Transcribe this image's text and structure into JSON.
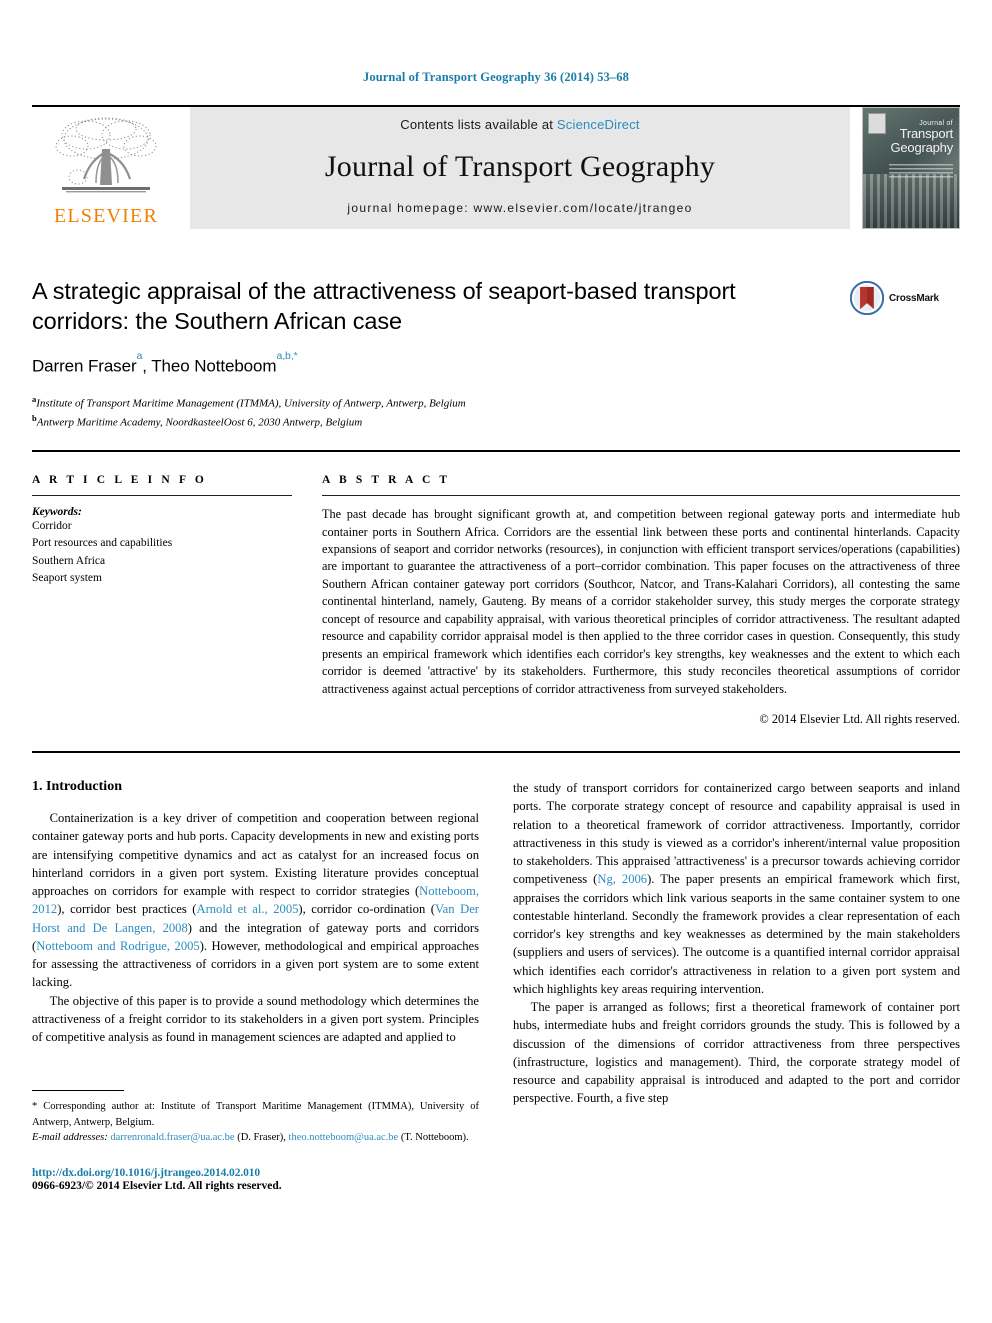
{
  "running_head": "Journal of Transport Geography 36 (2014) 53–68",
  "masthead": {
    "publisher_name": "ELSEVIER",
    "contents_prefix": "Contents lists available at",
    "sciencedirect": "ScienceDirect",
    "journal_title": "Journal of Transport Geography",
    "homepage": "journal homepage: www.elsevier.com/locate/jtrangeo",
    "cover": {
      "line1": "Journal of",
      "line2": "Transport",
      "line3": "Geography"
    }
  },
  "crossmark": {
    "label": "CrossMark"
  },
  "article": {
    "title": "A strategic appraisal of the attractiveness of seaport-based transport corridors: the Southern African case",
    "authors": [
      {
        "name": "Darren Fraser",
        "marks": "a"
      },
      {
        "name": "Theo Notteboom",
        "marks": "a,b,*"
      }
    ],
    "affiliations": [
      {
        "mark": "a",
        "text": "Institute of Transport Maritime Management (ITMMA), University of Antwerp, Antwerp, Belgium"
      },
      {
        "mark": "b",
        "text": "Antwerp Maritime Academy, NoordkasteelOost 6, 2030 Antwerp, Belgium"
      }
    ]
  },
  "article_info": {
    "heading": "A R T I C L E  I N F O",
    "keywords_label": "Keywords:",
    "keywords": [
      "Corridor",
      "Port resources and capabilities",
      "Southern Africa",
      "Seaport system"
    ]
  },
  "abstract": {
    "heading": "A B S T R A C T",
    "text": "The past decade has brought significant growth at, and competition between regional gateway ports and intermediate hub container ports in Southern Africa. Corridors are the essential link between these ports and continental hinterlands. Capacity expansions of seaport and corridor networks (resources), in conjunction with efficient transport services/operations (capabilities) are important to guarantee the attractiveness of a port–corridor combination. This paper focuses on the attractiveness of three Southern African container gateway port corridors (Southcor, Natcor, and Trans-Kalahari Corridors), all contesting the same continental hinterland, namely, Gauteng. By means of a corridor stakeholder survey, this study merges the corporate strategy concept of resource and capability appraisal, with various theoretical principles of corridor attractiveness. The resultant adapted resource and capability corridor appraisal model is then applied to the three corridor cases in question. Consequently, this study presents an empirical framework which identifies each corridor's key strengths, key weaknesses and the extent to which each corridor is deemed 'attractive' by its stakeholders. Furthermore, this study reconciles theoretical assumptions of corridor attractiveness against actual perceptions of corridor attractiveness from surveyed stakeholders.",
    "copyright": "© 2014 Elsevier Ltd. All rights reserved."
  },
  "body": {
    "section_title": "1. Introduction",
    "left_p1_a": "Containerization is a key driver of competition and cooperation between regional container gateway ports and hub ports. Capacity developments in new and existing ports are intensifying competitive dynamics and act as catalyst for an increased focus on hinterland corridors in a given port system. Existing literature provides conceptual approaches on corridors for example with respect to corridor strategies (",
    "cite1": "Notteboom, 2012",
    "left_p1_b": "), corridor best practices (",
    "cite2": "Arnold et al., 2005",
    "left_p1_c": "), corridor co-ordination (",
    "cite3": "Van Der Horst and De Langen, 2008",
    "left_p1_d": ") and the integration of gateway ports and corridors (",
    "cite4": "Notteboom and Rodrigue, 2005",
    "left_p1_e": "). However, methodological and empirical approaches for assessing the attractiveness of corridors in a given port system are to some extent lacking.",
    "left_p2": "The objective of this paper is to provide a sound methodology which determines the attractiveness of a freight corridor to its stakeholders in a given port system. Principles of competitive analysis as found in management sciences are adapted and applied to",
    "right_p1_a": "the study of transport corridors for containerized cargo between seaports and inland ports. The corporate strategy concept of resource and capability appraisal is used in relation to a theoretical framework of corridor attractiveness. Importantly, corridor attractiveness in this study is viewed as a corridor's inherent/internal value proposition to stakeholders. This appraised 'attractiveness' is a precursor towards achieving corridor competiveness (",
    "cite5": "Ng, 2006",
    "right_p1_b": "). The paper presents an empirical framework which first, appraises the corridors which link various seaports in the same container system to one contestable hinterland. Secondly the framework provides a clear representation of each corridor's key strengths and key weaknesses as determined by the main stakeholders (suppliers and users of services). The outcome is a quantified internal corridor appraisal which identifies each corridor's attractiveness in relation to a given port system and which highlights key areas requiring intervention.",
    "right_p2": "The paper is arranged as follows; first a theoretical framework of container port hubs, intermediate hubs and freight corridors grounds the study. This is followed by a discussion of the dimensions of corridor attractiveness from three perspectives (infrastructure, logistics and management). Third, the corporate strategy model of resource and capability appraisal is introduced and adapted to the port and corridor perspective. Fourth, a five step"
  },
  "footnotes": {
    "corresponding": "* Corresponding author at: Institute of Transport Maritime Management (ITMMA), University of Antwerp, Antwerp, Belgium.",
    "email_label": "E-mail addresses:",
    "email1": "darrenronald.fraser@ua.ac.be",
    "email1_owner": "(D. Fraser),",
    "email2": "theo.notteboom@ua.ac.be",
    "email2_owner": "(T. Notteboom)."
  },
  "footer": {
    "doi": "http://dx.doi.org/10.1016/j.jtrangeo.2014.02.010",
    "issn": "0966-6923/© 2014 Elsevier Ltd. All rights reserved."
  },
  "colors": {
    "link": "#2b8cbe",
    "running_head": "#1a7fa8",
    "elsevier_orange": "#f08000",
    "banner_bg": "#e7e7e7"
  }
}
